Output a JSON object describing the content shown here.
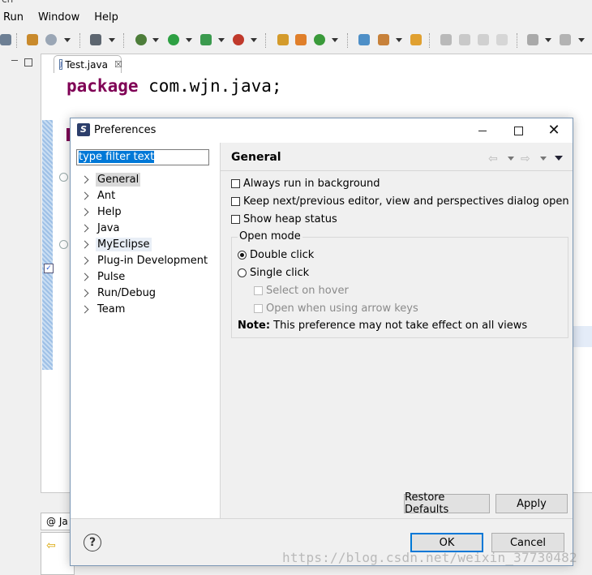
{
  "ide": {
    "menu": [
      "Run",
      "Window",
      "Help"
    ],
    "cut_top_text": "cn",
    "editor_tab": "Test.java",
    "editor_tab_close": "☒",
    "code_keyword": "package",
    "code_rest": " com.wjn.java;",
    "bottom_tab": "@ Ja"
  },
  "dialog": {
    "title": "Preferences",
    "app_icon_letter": "S",
    "filter_placeholder": "type filter text",
    "tree": [
      "General",
      "Ant",
      "Help",
      "Java",
      "MyEclipse",
      "Plug-in Development",
      "Pulse",
      "Run/Debug",
      "Team"
    ],
    "selected_tree_item": "General",
    "panel_title": "General",
    "options": {
      "always_run_bg": "Always run in background",
      "keep_next_prev": "Keep next/previous editor, view and perspectives dialog open",
      "show_heap": "Show heap status"
    },
    "open_mode": {
      "label": "Open mode",
      "double_click": "Double click",
      "single_click": "Single click",
      "select_on_hover": "Select on hover",
      "open_arrow_keys": "Open when using arrow keys",
      "selected": "Double click"
    },
    "note_label": "Note:",
    "note_text": " This preference may not take effect on all views",
    "buttons": {
      "restore_defaults": "Restore Defaults",
      "apply": "Apply",
      "ok": "OK",
      "cancel": "Cancel"
    },
    "help_glyph": "?"
  },
  "watermark": "https://blog.csdn.net/weixin_37730482"
}
